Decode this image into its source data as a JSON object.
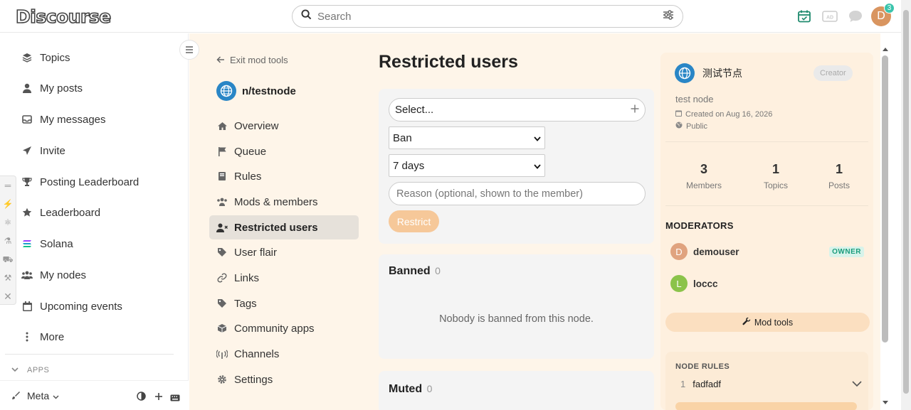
{
  "header": {
    "logo_text": "Discourse",
    "search_placeholder": "Search",
    "notification_count": "3",
    "avatar_letter": "D"
  },
  "sidebar": {
    "items": [
      {
        "label": "Topics",
        "icon": "layers-icon"
      },
      {
        "label": "My posts",
        "icon": "user-icon"
      },
      {
        "label": "My messages",
        "icon": "inbox-icon"
      },
      {
        "label": "Invite",
        "icon": "paper-plane-icon"
      },
      {
        "label": "Posting Leaderboard",
        "icon": "trophy-icon"
      },
      {
        "label": "Leaderboard",
        "icon": "star-icon"
      },
      {
        "label": "Solana",
        "icon": "solana-icon"
      },
      {
        "label": "My nodes",
        "icon": "users-icon"
      },
      {
        "label": "Upcoming events",
        "icon": "calendar-icon"
      },
      {
        "label": "More",
        "icon": "ellipsis-icon"
      }
    ],
    "apps_label": "APPS",
    "meta_label": "Meta"
  },
  "modnav": {
    "exit_label": "Exit mod tools",
    "node_name": "n/testnode",
    "items": [
      {
        "label": "Overview",
        "icon": "home-icon"
      },
      {
        "label": "Queue",
        "icon": "flag-icon"
      },
      {
        "label": "Rules",
        "icon": "book-icon"
      },
      {
        "label": "Mods & members",
        "icon": "users-icon"
      },
      {
        "label": "Restricted users",
        "icon": "user-x-icon"
      },
      {
        "label": "User flair",
        "icon": "tag-icon"
      },
      {
        "label": "Links",
        "icon": "link-icon"
      },
      {
        "label": "Tags",
        "icon": "tag-icon"
      },
      {
        "label": "Community apps",
        "icon": "box-icon"
      },
      {
        "label": "Channels",
        "icon": "broadcast-icon"
      },
      {
        "label": "Settings",
        "icon": "gear-icon"
      }
    ]
  },
  "content": {
    "page_title": "Restricted users",
    "user_select_placeholder": "Select...",
    "action_value": "Ban",
    "duration_value": "7 days",
    "reason_placeholder": "Reason (optional, shown to the member)",
    "restrict_label": "Restrict",
    "banned_title": "Banned",
    "banned_count": "0",
    "banned_empty": "Nobody is banned from this node.",
    "muted_title": "Muted",
    "muted_count": "0"
  },
  "node_card": {
    "name": "测试节点",
    "creator_label": "Creator",
    "description": "test node",
    "created": "Created on Aug 16, 2026",
    "visibility": "Public",
    "stats": [
      {
        "value": "3",
        "label": "Members"
      },
      {
        "value": "1",
        "label": "Topics"
      },
      {
        "value": "1",
        "label": "Posts"
      }
    ],
    "moderators_title": "MODERATORS",
    "moderators": [
      {
        "letter": "D",
        "name": "demouser",
        "badge": "OWNER",
        "color": "#e0a37f"
      },
      {
        "letter": "L",
        "name": "loccc",
        "badge": "",
        "color": "#8bc34a"
      }
    ],
    "mod_tools_label": "Mod tools",
    "rules_title": "NODE RULES",
    "rules": [
      {
        "num": "1",
        "text": "fadfadf"
      }
    ]
  }
}
